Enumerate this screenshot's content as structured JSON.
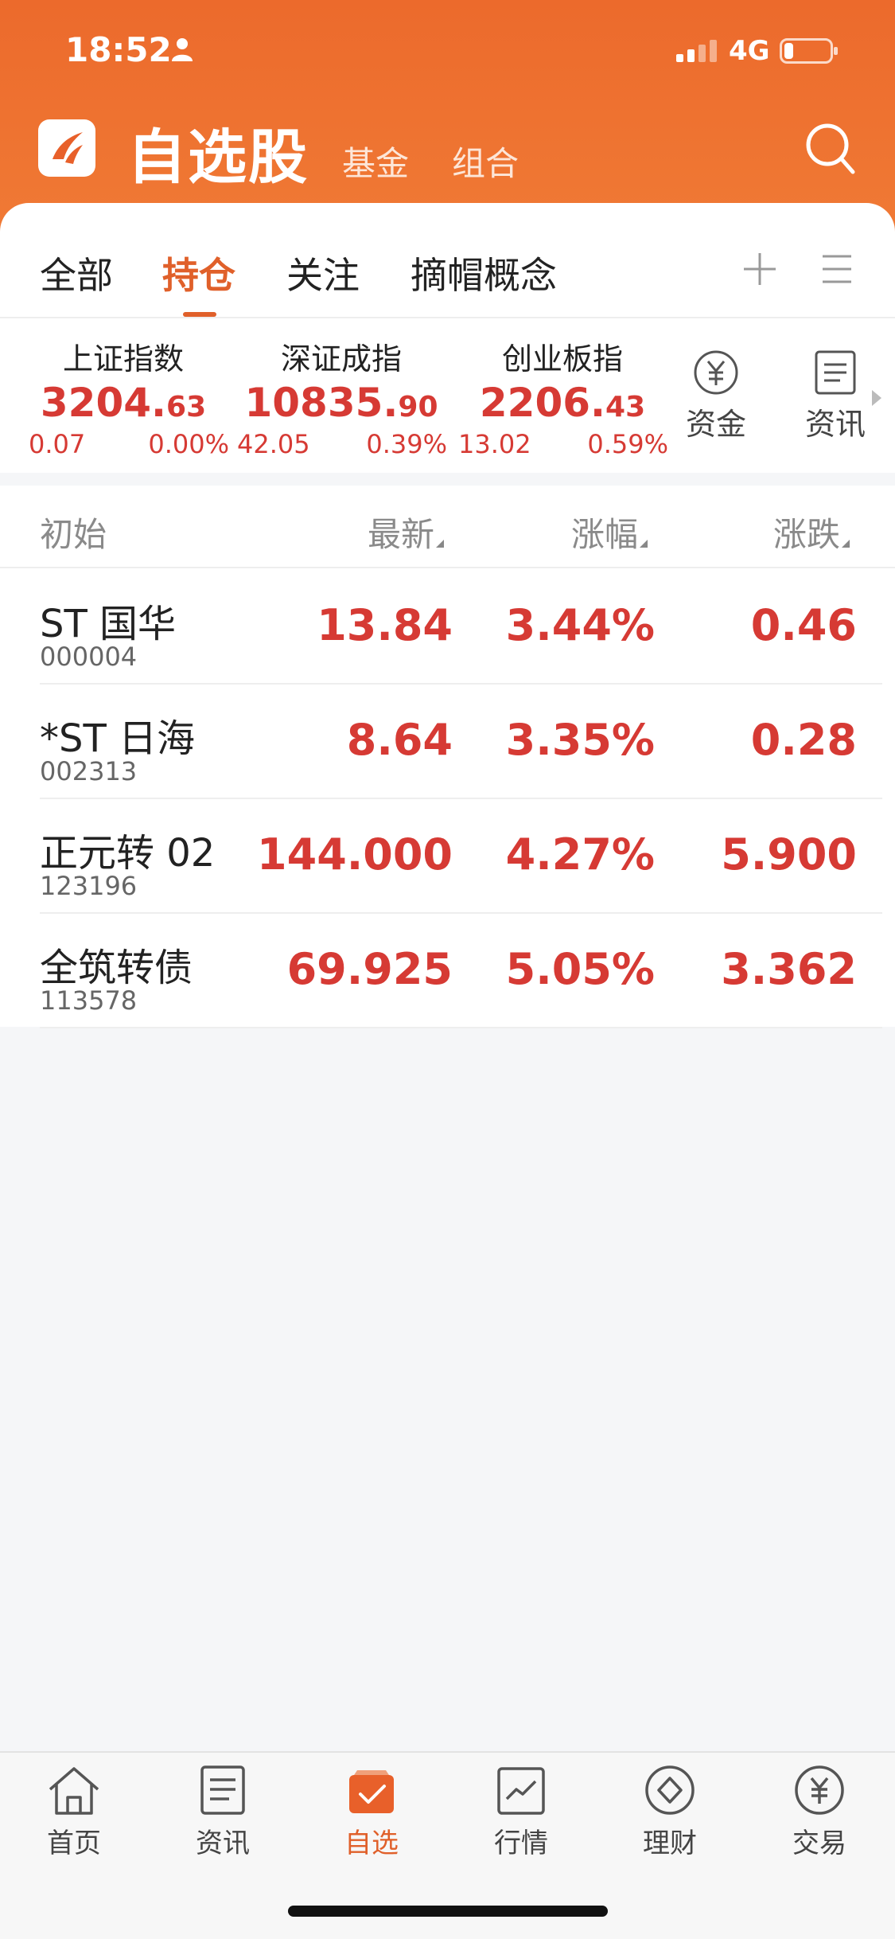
{
  "status": {
    "time": "18:52",
    "network": "4G"
  },
  "header": {
    "title": "自选股",
    "tabs": [
      "基金",
      "组合"
    ]
  },
  "sub_tabs": [
    "全部",
    "持仓",
    "关注",
    "摘帽概念"
  ],
  "indices": [
    {
      "name": "上证指数",
      "int": "3204.",
      "dec": "63",
      "chg": "0.07",
      "pct": "0.00%"
    },
    {
      "name": "深证成指",
      "int": "10835.",
      "dec": "90",
      "chg": "42.05",
      "pct": "0.39%"
    },
    {
      "name": "创业板指",
      "int": "2206.",
      "dec": "43",
      "chg": "13.02",
      "pct": "0.59%"
    }
  ],
  "quick": [
    {
      "label": "资金"
    },
    {
      "label": "资讯"
    }
  ],
  "list": {
    "headers": {
      "name": "初始",
      "latest": "最新",
      "pct": "涨幅",
      "change": "涨跌"
    },
    "rows": [
      {
        "name": "ST 国华",
        "code": "000004",
        "latest": "13.84",
        "pct": "3.44%",
        "change": "0.46"
      },
      {
        "name": "*ST 日海",
        "code": "002313",
        "latest": "8.64",
        "pct": "3.35%",
        "change": "0.28"
      },
      {
        "name": "正元转 02",
        "code": "123196",
        "latest": "144.000",
        "pct": "4.27%",
        "change": "5.900"
      },
      {
        "name": "全筑转债",
        "code": "113578",
        "latest": "69.925",
        "pct": "5.05%",
        "change": "3.362"
      }
    ]
  },
  "nav": [
    {
      "label": "首页",
      "icon": "home-icon"
    },
    {
      "label": "资讯",
      "icon": "news-icon"
    },
    {
      "label": "自选",
      "icon": "watchlist-icon"
    },
    {
      "label": "行情",
      "icon": "market-icon"
    },
    {
      "label": "理财",
      "icon": "finance-icon"
    },
    {
      "label": "交易",
      "icon": "trade-icon"
    }
  ],
  "colors": {
    "brand": "#ec6a2c",
    "up": "#d63a34"
  }
}
